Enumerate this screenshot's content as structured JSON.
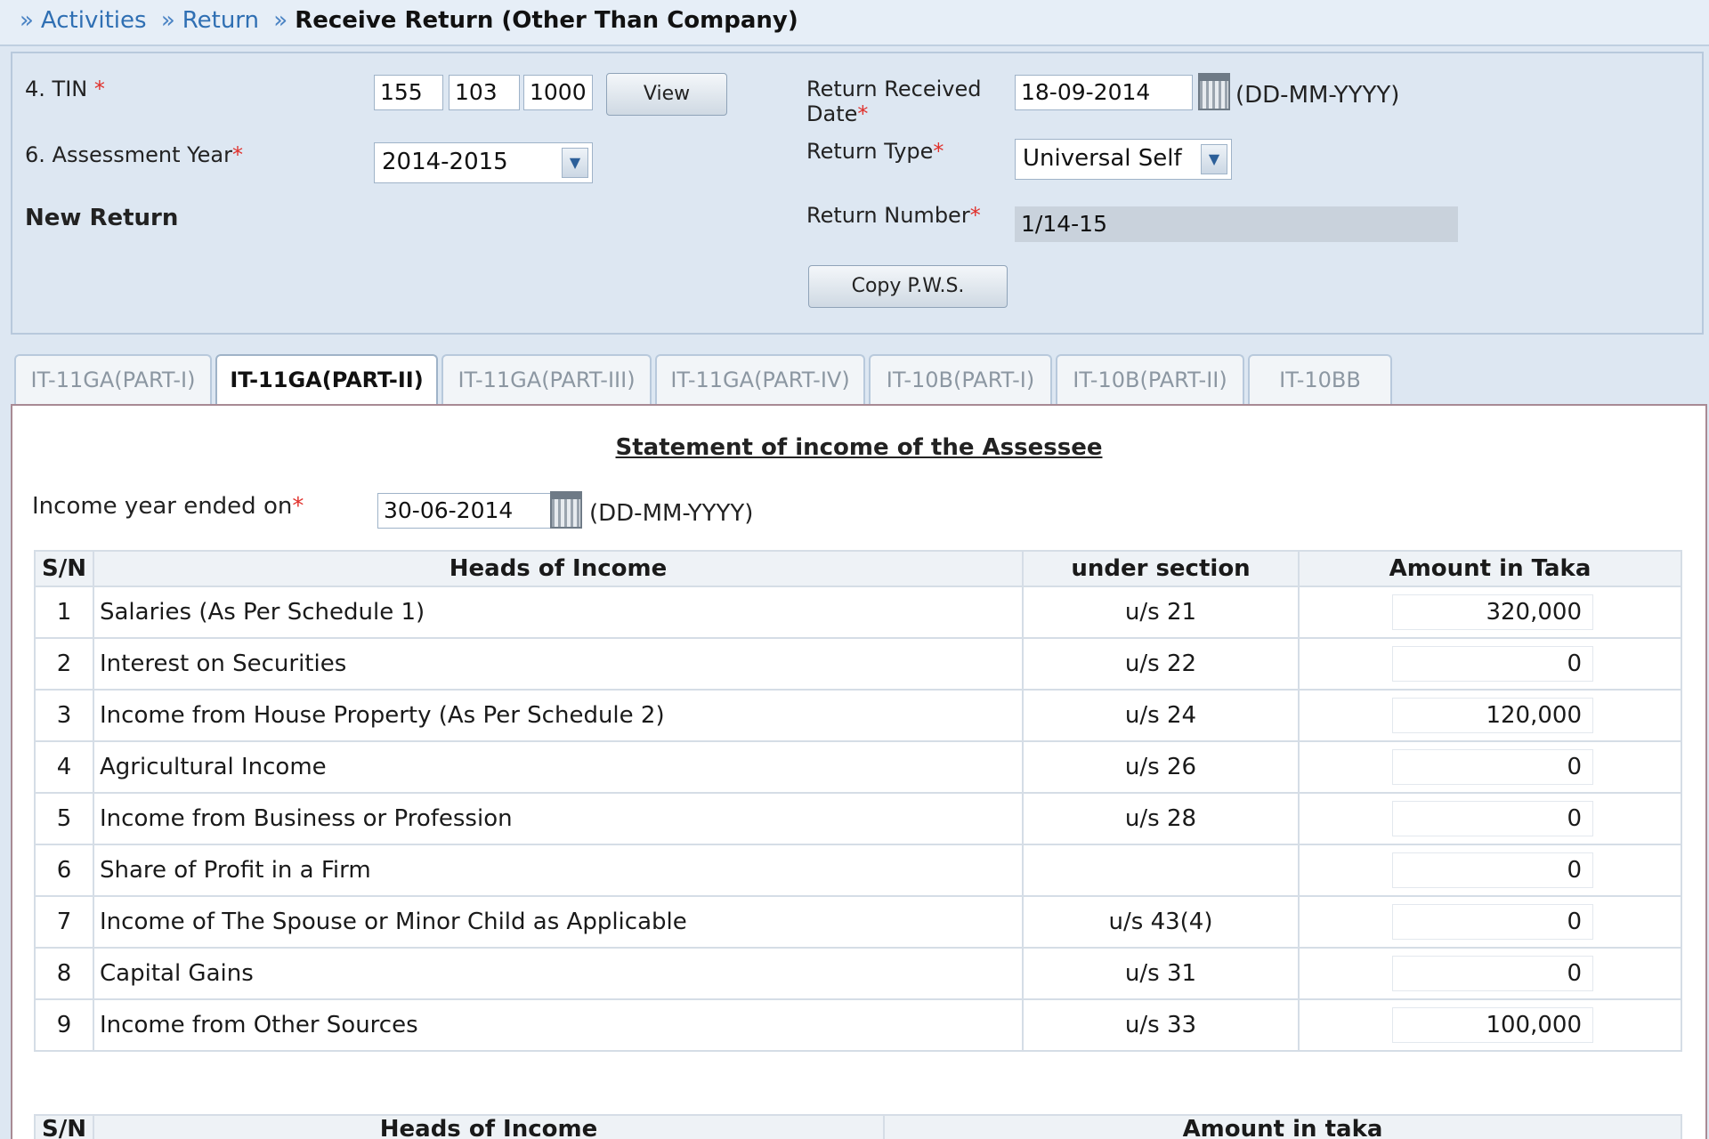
{
  "breadcrumb": {
    "sep": "»",
    "items": [
      "Activities",
      "Return"
    ],
    "current": "Receive Return (Other Than Company)"
  },
  "form": {
    "tin_label": "4. TIN",
    "tin": [
      "155",
      "103",
      "1000"
    ],
    "view_button": "View",
    "assessment_year_label": "6. Assessment Year",
    "assessment_year": "2014-2015",
    "new_return": "New Return",
    "received_date_label": "Return Received Date",
    "received_date": "18-09-2014",
    "date_format": "(DD-MM-YYYY)",
    "return_type_label": "Return Type",
    "return_type": "Universal Self",
    "return_number_label": "Return Number",
    "return_number": "1/14-15",
    "copy_button": "Copy P.W.S.",
    "required_mark": "*"
  },
  "tabs": [
    "IT-11GA(PART-I)",
    "IT-11GA(PART-II)",
    "IT-11GA(PART-III)",
    "IT-11GA(PART-IV)",
    "IT-10B(PART-I)",
    "IT-10B(PART-II)",
    "IT-10BB"
  ],
  "active_tab": 1,
  "statement": {
    "title": "Statement of income of the Assessee",
    "income_year_label": "Income year ended on",
    "income_year": "30-06-2014",
    "date_format": "(DD-MM-YYYY)",
    "columns": [
      "S/N",
      "Heads of Income",
      "under section",
      "Amount in Taka"
    ],
    "rows": [
      {
        "sn": "1",
        "head": "Salaries (As Per Schedule 1)",
        "section": "u/s 21",
        "amount": "320,000"
      },
      {
        "sn": "2",
        "head": "Interest on Securities",
        "section": "u/s 22",
        "amount": "0"
      },
      {
        "sn": "3",
        "head": "Income from House Property (As Per Schedule 2)",
        "section": "u/s 24",
        "amount": "120,000"
      },
      {
        "sn": "4",
        "head": "Agricultural Income",
        "section": "u/s 26",
        "amount": "0"
      },
      {
        "sn": "5",
        "head": "Income from Business or Profession",
        "section": "u/s 28",
        "amount": "0"
      },
      {
        "sn": "6",
        "head": "Share of Profit in a Firm",
        "section": "",
        "amount": "0"
      },
      {
        "sn": "7",
        "head": "Income of The Spouse or Minor Child as Applicable",
        "section": "u/s 43(4)",
        "amount": "0"
      },
      {
        "sn": "8",
        "head": "Capital Gains",
        "section": "u/s 31",
        "amount": "0"
      },
      {
        "sn": "9",
        "head": "Income from Other Sources",
        "section": "u/s 33",
        "amount": "100,000"
      }
    ],
    "second_columns": [
      "S/N",
      "Heads of Income",
      "Amount in taka"
    ]
  }
}
